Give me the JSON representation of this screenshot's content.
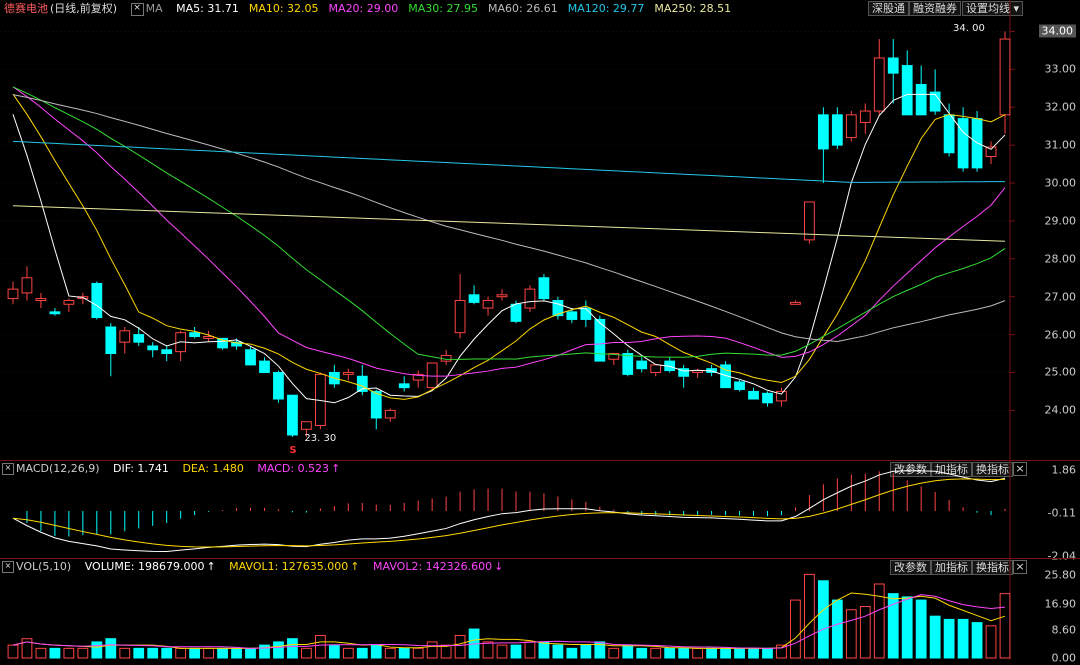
{
  "main": {
    "stock": "德赛电池",
    "period": "(日线,前复权)",
    "ma_labels": [
      {
        "text": "MA5: 31.71",
        "color": "#ffffff"
      },
      {
        "text": "MA10: 32.05",
        "color": "#ffd700"
      },
      {
        "text": "MA20: 29.00",
        "color": "#ff44ff"
      },
      {
        "text": "MA30: 27.95",
        "color": "#33dd33"
      },
      {
        "text": "MA60: 26.61",
        "color": "#bbbbbb"
      },
      {
        "text": "MA120: 29.77",
        "color": "#22c8e8"
      },
      {
        "text": "MA250: 28.51",
        "color": "#e8e8a0"
      }
    ],
    "buttons": {
      "sz": "深股通",
      "rz": "融资融券",
      "set": "设置均线"
    },
    "y_ticks": [
      "34.00",
      "33.00",
      "32.00",
      "31.00",
      "30.00",
      "29.00",
      "28.00",
      "27.00",
      "26.00",
      "25.00",
      "24.00"
    ],
    "high_label": "34. 00",
    "low_label": "23. 30",
    "low_marker": "S",
    "up_color": "#ff4444",
    "down_color": "#00ffff"
  },
  "macd": {
    "title": "MACD(12,26,9)",
    "dif": "DIF: 1.741",
    "dea": "DEA: 1.480",
    "macd": "MACD: 0.523",
    "buttons": {
      "params": "改参数",
      "add": "加指标",
      "swap": "换指标"
    },
    "y_ticks": [
      "1.86",
      "-0.11",
      "-2.04"
    ]
  },
  "vol": {
    "title": "VOL(5,10)",
    "volume": "VOLUME: 198679.000",
    "mavol1": "MAVOL1: 127635.000",
    "mavol2": "MAVOL2: 142326.600",
    "buttons": {
      "params": "改参数",
      "add": "加指标",
      "swap": "换指标"
    },
    "y_ticks": [
      "25.80",
      "16.90",
      "8.60",
      "0.00"
    ]
  },
  "close_icon": "close-icon",
  "chart_data": {
    "type": "candlestick",
    "y_range": [
      23.3,
      34.0
    ],
    "candles": [
      [
        26.95,
        27.4,
        26.8,
        27.2
      ],
      [
        27.1,
        27.8,
        26.9,
        27.5
      ],
      [
        26.9,
        27.1,
        26.7,
        26.95
      ],
      [
        26.6,
        26.7,
        26.5,
        26.55
      ],
      [
        26.8,
        26.95,
        26.6,
        26.9
      ],
      [
        26.95,
        27.1,
        26.8,
        27.0
      ],
      [
        27.35,
        27.4,
        26.4,
        26.45
      ],
      [
        26.2,
        26.3,
        24.9,
        25.5
      ],
      [
        25.8,
        26.2,
        25.5,
        26.1
      ],
      [
        26.0,
        26.2,
        25.7,
        25.8
      ],
      [
        25.7,
        25.8,
        25.4,
        25.6
      ],
      [
        25.6,
        25.7,
        25.3,
        25.5
      ],
      [
        25.55,
        26.1,
        25.3,
        26.05
      ],
      [
        26.05,
        26.2,
        25.9,
        25.95
      ],
      [
        25.9,
        26.1,
        25.8,
        25.95
      ],
      [
        25.9,
        25.9,
        25.6,
        25.65
      ],
      [
        25.8,
        25.9,
        25.6,
        25.7
      ],
      [
        25.6,
        25.7,
        25.2,
        25.2
      ],
      [
        25.3,
        25.4,
        25.0,
        25.0
      ],
      [
        25.0,
        25.05,
        24.2,
        24.3
      ],
      [
        24.4,
        24.4,
        23.3,
        23.35
      ],
      [
        23.5,
        23.7,
        23.3,
        23.7
      ],
      [
        23.6,
        25.0,
        23.5,
        24.95
      ],
      [
        25.0,
        25.2,
        24.6,
        24.7
      ],
      [
        24.95,
        25.1,
        24.8,
        25.0
      ],
      [
        24.9,
        25.2,
        24.4,
        24.5
      ],
      [
        24.5,
        24.55,
        23.5,
        23.8
      ],
      [
        23.8,
        24.05,
        23.7,
        24.0
      ],
      [
        24.7,
        24.9,
        24.5,
        24.6
      ],
      [
        24.8,
        25.05,
        24.6,
        24.95
      ],
      [
        24.6,
        25.2,
        24.55,
        25.25
      ],
      [
        25.3,
        25.6,
        25.2,
        25.45
      ],
      [
        26.05,
        27.6,
        25.9,
        26.9
      ],
      [
        27.05,
        27.3,
        26.8,
        26.85
      ],
      [
        26.7,
        27.0,
        26.5,
        26.9
      ],
      [
        27.0,
        27.2,
        26.9,
        27.05
      ],
      [
        26.8,
        26.9,
        26.3,
        26.35
      ],
      [
        26.7,
        27.3,
        26.6,
        27.2
      ],
      [
        27.5,
        27.6,
        26.9,
        26.95
      ],
      [
        26.9,
        27.0,
        26.4,
        26.5
      ],
      [
        26.6,
        26.7,
        26.3,
        26.4
      ],
      [
        26.7,
        26.9,
        26.2,
        26.4
      ],
      [
        26.4,
        26.5,
        25.3,
        25.3
      ],
      [
        25.35,
        25.5,
        25.2,
        25.5
      ],
      [
        25.5,
        25.6,
        24.9,
        24.95
      ],
      [
        25.3,
        25.4,
        25.0,
        25.1
      ],
      [
        25.0,
        25.2,
        24.9,
        25.2
      ],
      [
        25.3,
        25.4,
        25.0,
        25.05
      ],
      [
        25.1,
        25.2,
        24.6,
        24.9
      ],
      [
        25.0,
        25.1,
        24.85,
        25.05
      ],
      [
        25.1,
        25.2,
        24.9,
        25.0
      ],
      [
        25.2,
        25.3,
        24.6,
        24.6
      ],
      [
        24.75,
        24.8,
        24.5,
        24.55
      ],
      [
        24.5,
        24.6,
        24.3,
        24.3
      ],
      [
        24.45,
        24.5,
        24.1,
        24.2
      ],
      [
        24.25,
        24.6,
        24.1,
        24.5
      ],
      [
        26.8,
        26.9,
        26.8,
        26.85
      ],
      [
        28.5,
        29.5,
        28.4,
        29.5
      ],
      [
        31.8,
        32.0,
        30.0,
        30.9
      ],
      [
        31.8,
        32.0,
        30.9,
        31.0
      ],
      [
        31.2,
        31.9,
        31.1,
        31.8
      ],
      [
        31.6,
        32.1,
        31.3,
        31.9
      ],
      [
        31.9,
        33.8,
        31.8,
        33.3
      ],
      [
        33.3,
        33.8,
        32.1,
        32.9
      ],
      [
        33.1,
        33.5,
        32.0,
        31.8
      ],
      [
        32.6,
        33.1,
        32.2,
        31.8
      ],
      [
        32.4,
        33.0,
        31.8,
        31.9
      ],
      [
        31.8,
        32.1,
        30.7,
        30.8
      ],
      [
        31.7,
        32.0,
        30.3,
        30.4
      ],
      [
        31.7,
        31.9,
        30.3,
        30.4
      ],
      [
        30.7,
        31.1,
        30.5,
        30.95
      ],
      [
        31.8,
        34.0,
        31.3,
        33.8
      ]
    ],
    "macd_range": [
      -2.04,
      1.86
    ],
    "vol_range": [
      0,
      25.8
    ],
    "volumes": [
      4,
      6,
      3,
      3,
      3,
      3,
      5,
      6,
      3,
      3,
      3,
      3,
      3,
      3,
      3,
      3,
      3,
      3,
      4,
      5,
      6,
      3,
      7,
      4,
      3,
      3,
      4,
      3,
      3,
      3,
      5,
      4,
      7,
      9,
      5,
      4,
      4,
      5,
      5,
      4,
      3,
      4,
      5,
      3,
      4,
      3,
      3,
      3,
      3,
      3,
      3,
      3,
      3,
      3,
      3,
      4,
      18,
      26,
      24,
      18,
      15,
      16,
      23,
      20,
      19,
      18,
      13,
      12,
      12,
      11,
      10,
      20
    ]
  }
}
